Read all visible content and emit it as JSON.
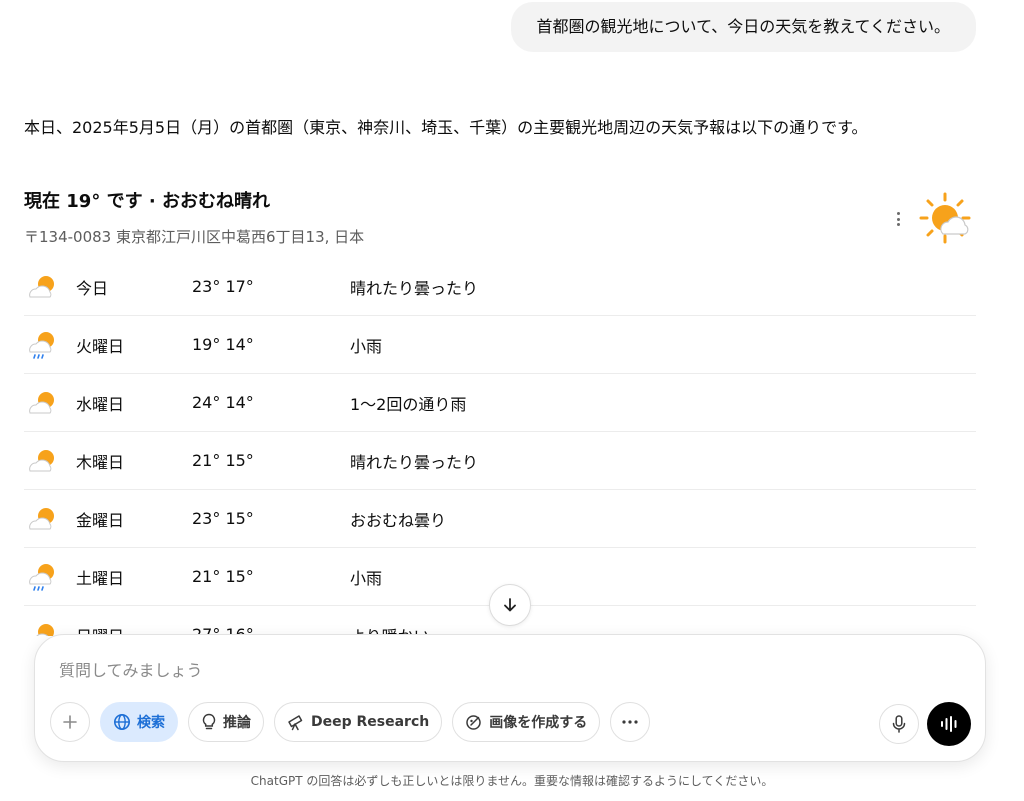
{
  "user_message": "首都圏の観光地について、今日の天気を教えてください。",
  "answer_intro": "本日、2025年5月5日（月）の首都圏（東京、神奈川、埼玉、千葉）の主要観光地周辺の天気予報は以下の通りです。",
  "weather": {
    "current": "現在 19° です · おおむね晴れ",
    "location": "〒134-0083 東京都江戸川区中葛西6丁目13, 日本",
    "current_icon": "sun-cloud-icon",
    "forecast": [
      {
        "day": "今日",
        "temps": "23° 17°",
        "desc": "晴れたり曇ったり",
        "icon": "partly-cloudy"
      },
      {
        "day": "火曜日",
        "temps": "19° 14°",
        "desc": "小雨",
        "icon": "rain"
      },
      {
        "day": "水曜日",
        "temps": "24° 14°",
        "desc": "1〜2回の通り雨",
        "icon": "partly-cloudy"
      },
      {
        "day": "木曜日",
        "temps": "21° 15°",
        "desc": "晴れたり曇ったり",
        "icon": "partly-cloudy"
      },
      {
        "day": "金曜日",
        "temps": "23° 15°",
        "desc": "おおむね曇り",
        "icon": "partly-cloudy"
      },
      {
        "day": "土曜日",
        "temps": "21° 15°",
        "desc": "小雨",
        "icon": "rain"
      },
      {
        "day": "日曜日",
        "temps": "27° 16°",
        "desc": "より暖かい",
        "icon": "partly-cloudy"
      }
    ]
  },
  "composer": {
    "placeholder": "質問してみましょう",
    "search_label": "検索",
    "reason_label": "推論",
    "deep_research_label": "Deep Research",
    "create_image_label": "画像を作成する"
  },
  "disclaimer": "ChatGPT の回答は必ずしも正しいとは限りません。重要な情報は確認するようにしてください。",
  "colors": {
    "accent_blue": "#1d6fd6",
    "search_pill_bg": "#dbeafe",
    "sun_orange": "#f7a21b"
  }
}
